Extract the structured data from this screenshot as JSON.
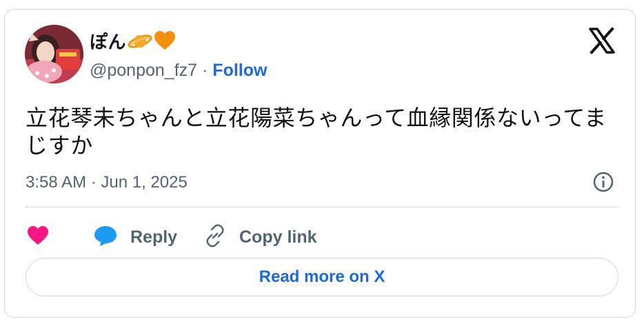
{
  "author": {
    "display_name": "ぽん",
    "name_emojis": [
      "planet-emoji",
      "orange-heart-emoji"
    ],
    "handle": "@ponpon_fz7",
    "separator": "·",
    "follow_label": "Follow"
  },
  "tweet": {
    "text": "立花琴未ちゃんと立花陽菜ちゃんって血縁関係ないってまじすか",
    "timestamp": "3:58 AM · Jun 1, 2025"
  },
  "actions": {
    "like_icon": "heart-icon",
    "reply_label": "Reply",
    "copy_label": "Copy link"
  },
  "read_more_label": "Read more on X",
  "colors": {
    "like": "#f91880",
    "reply": "#1d9bf0",
    "link": "#1d6ad8",
    "muted": "#536471",
    "border": "#cfd9de"
  }
}
